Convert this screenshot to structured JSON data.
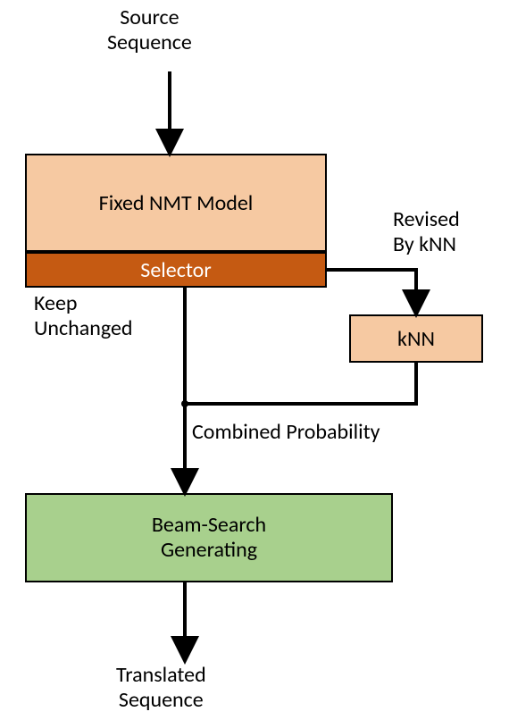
{
  "source_sequence": "Source\nSequence",
  "fixed_nmt": "Fixed NMT Model",
  "selector": "Selector",
  "keep_unchanged": "Keep\nUnchanged",
  "revised_by_knn": "Revised\nBy kNN",
  "knn": "kNN",
  "combined_probability": "Combined Probability",
  "beam_search": "Beam-Search\nGenerating",
  "translated_sequence": "Translated\nSequence",
  "colors": {
    "light_orange": "#f6c9a2",
    "dark_orange": "#c55a12",
    "green": "#a8d08d"
  }
}
